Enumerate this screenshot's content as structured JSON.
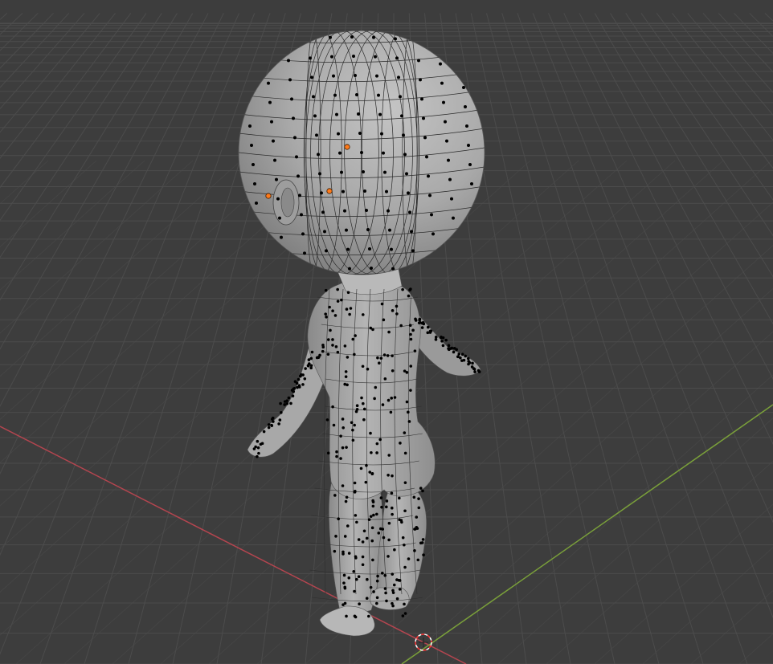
{
  "viewport": {
    "mode": "edit-mode",
    "background_color": "#3d3d3d",
    "grid_color": "#4c4c4c",
    "x_axis_color": "#b4454f",
    "y_axis_color": "#7aa03a",
    "mesh_color": "#a8a8a8",
    "vertex_color": "#000000",
    "selected_vertex_color": "#ff7a1a",
    "cursor_colors": [
      "#ff3333",
      "#ffffff"
    ]
  },
  "object": {
    "kind": "chibi-character-mesh",
    "selected_vertices": 3
  }
}
